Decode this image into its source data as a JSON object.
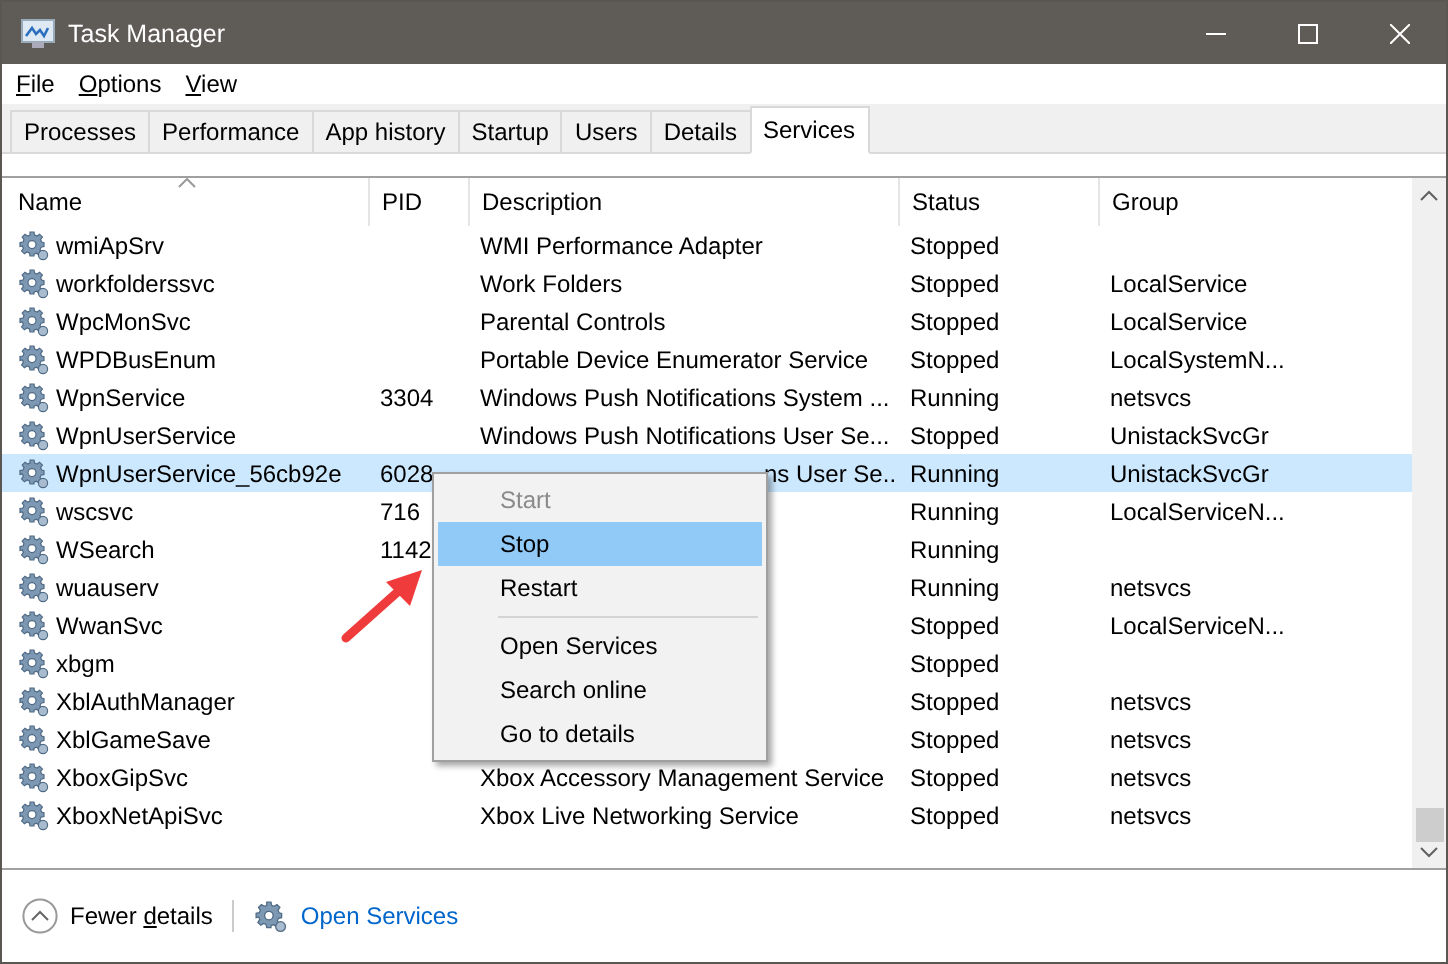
{
  "window": {
    "title": "Task Manager"
  },
  "menu": [
    {
      "accel": "F",
      "after": "ile"
    },
    {
      "accel": "O",
      "after": "ptions"
    },
    {
      "accel": "V",
      "after": "iew"
    }
  ],
  "tabs": [
    {
      "label": "Processes",
      "selected": false
    },
    {
      "label": "Performance",
      "selected": false
    },
    {
      "label": "App history",
      "selected": false
    },
    {
      "label": "Startup",
      "selected": false
    },
    {
      "label": "Users",
      "selected": false
    },
    {
      "label": "Details",
      "selected": false
    },
    {
      "label": "Services",
      "selected": true
    }
  ],
  "table": {
    "columns": [
      "Name",
      "PID",
      "Description",
      "Status",
      "Group"
    ],
    "rows": [
      {
        "name": "wmiApSrv",
        "description": "WMI Performance Adapter",
        "status": "Stopped",
        "selected": false
      },
      {
        "name": "workfolderssvc",
        "description": "Work Folders",
        "status": "Stopped",
        "group": "LocalService",
        "selected": false
      },
      {
        "name": "WpcMonSvc",
        "description": "Parental Controls",
        "status": "Stopped",
        "group": "LocalService",
        "selected": false
      },
      {
        "name": "WPDBusEnum",
        "description": "Portable Device Enumerator Service",
        "status": "Stopped",
        "group": "LocalSystemN...",
        "selected": false
      },
      {
        "name": "WpnService",
        "pid": "3304",
        "description": "Windows Push Notifications System ...",
        "status": "Running",
        "group": "netsvcs",
        "selected": false
      },
      {
        "name": "WpnUserService",
        "description": "Windows Push Notifications User Se...",
        "status": "Stopped",
        "group": "UnistackSvcGr",
        "selected": false
      },
      {
        "name": "WpnUserService_56cb92e",
        "pid": "6028",
        "description_tail": "ns User Se...",
        "status": "Running",
        "group": "UnistackSvcGr",
        "selected": true
      },
      {
        "name": "wscsvc",
        "pid": "716",
        "status": "Running",
        "group": "LocalServiceN...",
        "selected": false
      },
      {
        "name": "WSearch",
        "pid": "1142",
        "status": "Running",
        "selected": false
      },
      {
        "name": "wuauserv",
        "status": "Running",
        "group": "netsvcs",
        "selected": false
      },
      {
        "name": "WwanSvc",
        "status": "Stopped",
        "group": "LocalServiceN...",
        "selected": false
      },
      {
        "name": "xbgm",
        "status": "Stopped",
        "selected": false
      },
      {
        "name": "XblAuthManager",
        "status": "Stopped",
        "group": "netsvcs",
        "selected": false
      },
      {
        "name": "XblGameSave",
        "status": "Stopped",
        "group": "netsvcs",
        "selected": false
      },
      {
        "name": "XboxGipSvc",
        "description": "Xbox Accessory Management Service",
        "status": "Stopped",
        "group": "netsvcs",
        "selected": false
      },
      {
        "name": "XboxNetApiSvc",
        "description": "Xbox Live Networking Service",
        "status": "Stopped",
        "group": "netsvcs",
        "selected": false
      }
    ]
  },
  "context_menu": {
    "items": [
      {
        "kind": "item",
        "label": "Start",
        "disabled": true,
        "selected": false
      },
      {
        "kind": "item",
        "label": "Stop",
        "disabled": false,
        "selected": true
      },
      {
        "kind": "item",
        "label": "Restart",
        "disabled": false,
        "selected": false
      },
      {
        "kind": "separator"
      },
      {
        "kind": "item",
        "label": "Open Services",
        "disabled": false,
        "selected": false
      },
      {
        "kind": "item",
        "label": "Search online",
        "disabled": false,
        "selected": false
      },
      {
        "kind": "item",
        "label": "Go to details",
        "disabled": false,
        "selected": false
      }
    ]
  },
  "footer": {
    "fewer_details": {
      "before": "Fewer ",
      "accel": "d",
      "after": "etails"
    },
    "open_services": "Open Services"
  }
}
